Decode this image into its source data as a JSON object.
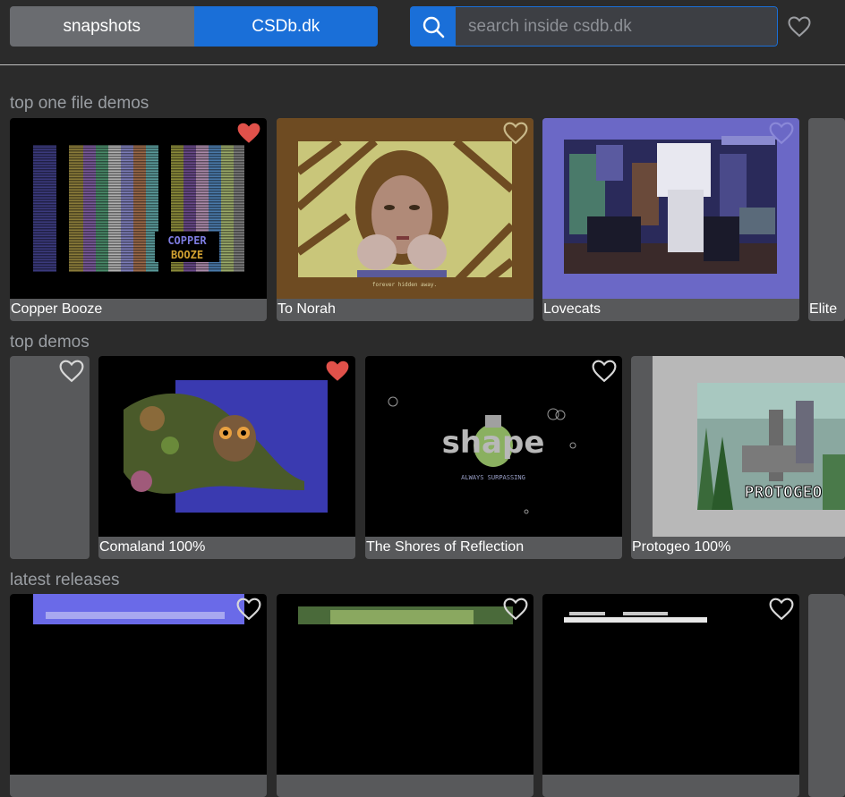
{
  "header": {
    "tab_snapshots": "snapshots",
    "tab_csdb": "CSDb.dk",
    "search_placeholder": "search inside csdb.dk"
  },
  "sections": [
    {
      "title": "top one file demos",
      "items": [
        {
          "label": "Copper Booze",
          "favorited": true
        },
        {
          "label": "To Norah",
          "favorited": false
        },
        {
          "label": "Lovecats",
          "favorited": false
        },
        {
          "label": "Elite",
          "favorited": false
        }
      ]
    },
    {
      "title": "top demos",
      "items": [
        {
          "label": "",
          "favorited": false
        },
        {
          "label": "Comaland 100%",
          "favorited": true
        },
        {
          "label": "The Shores of Reflection",
          "favorited": false
        },
        {
          "label": "Protogeo 100%",
          "favorited": false
        }
      ]
    },
    {
      "title": "latest releases",
      "items": []
    }
  ],
  "thumb_text": {
    "copper_line1": "COPPER",
    "copper_line2": "BOOZE",
    "norah_caption": "forever hidden away.",
    "shores_logo": "shape",
    "shores_tagline": "ALWAYS SURPASSING",
    "protogeo_logo": "PROTOGEO"
  },
  "colors": {
    "accent_blue": "#1a6fd8",
    "heart_red": "#e0514a"
  }
}
